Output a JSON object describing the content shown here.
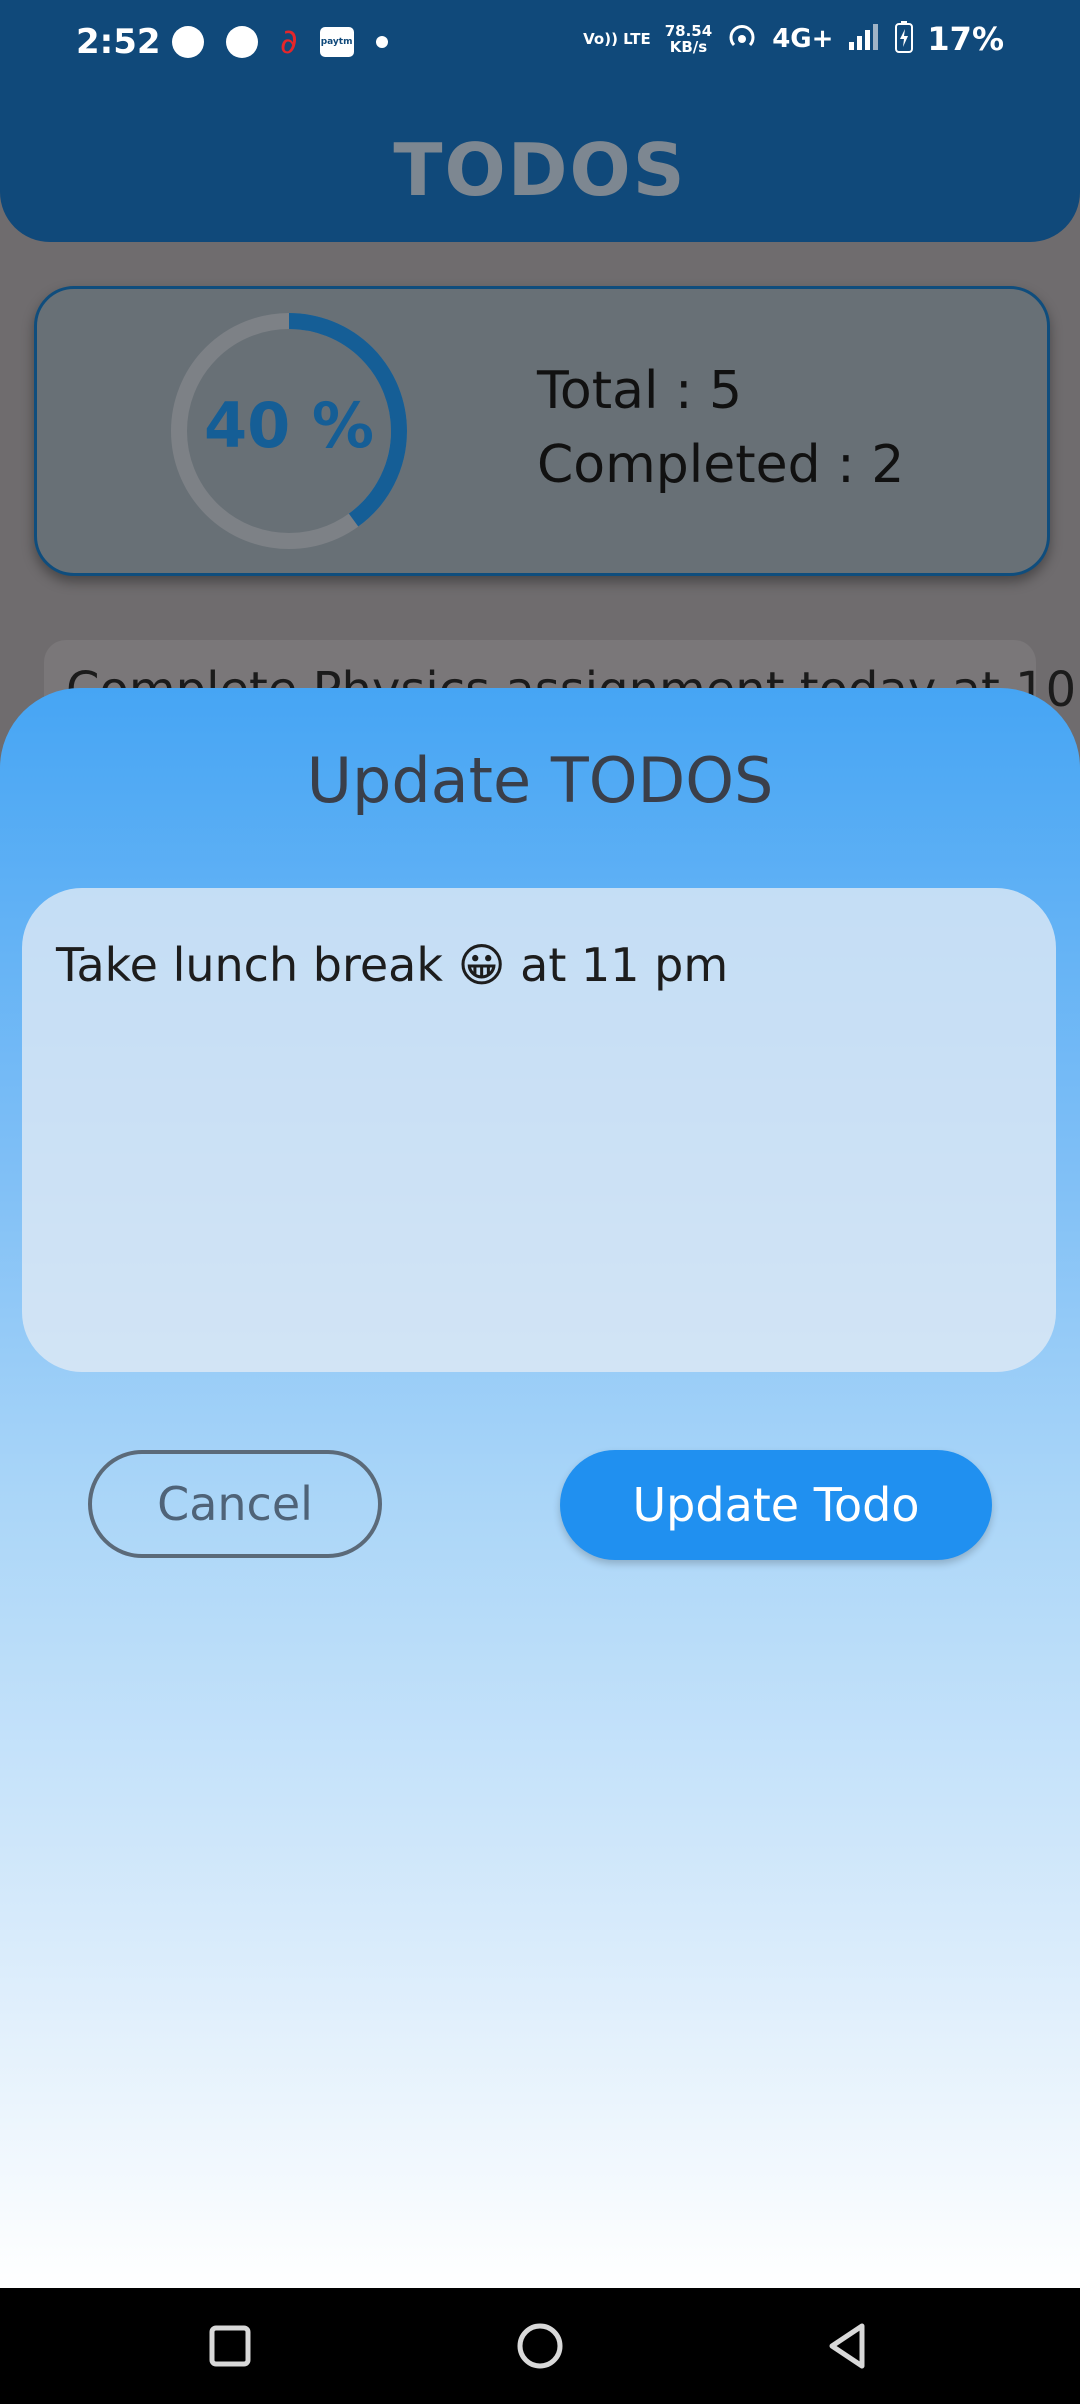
{
  "status_bar": {
    "time": "2:52",
    "network_speed_value": "78.54",
    "network_speed_unit": "KB/s",
    "volte": "Vo)) LTE",
    "network_type": "4G+",
    "battery": "17%"
  },
  "header": {
    "title": "TODOS"
  },
  "stats": {
    "progress_percent": 40,
    "percent_label": "40 %",
    "total": "Total : 5",
    "completed": "Completed : 2"
  },
  "list": {
    "first_item_text": "Complete Physics assignment today at 10"
  },
  "dialog": {
    "title": "Update TODOS",
    "input_value": "Take lunch break 😀 at 11 pm",
    "cancel_label": "Cancel",
    "update_label": "Update Todo"
  },
  "colors": {
    "header_bg": "#10497a",
    "accent": "#2090f0",
    "progress": "#155e96"
  }
}
